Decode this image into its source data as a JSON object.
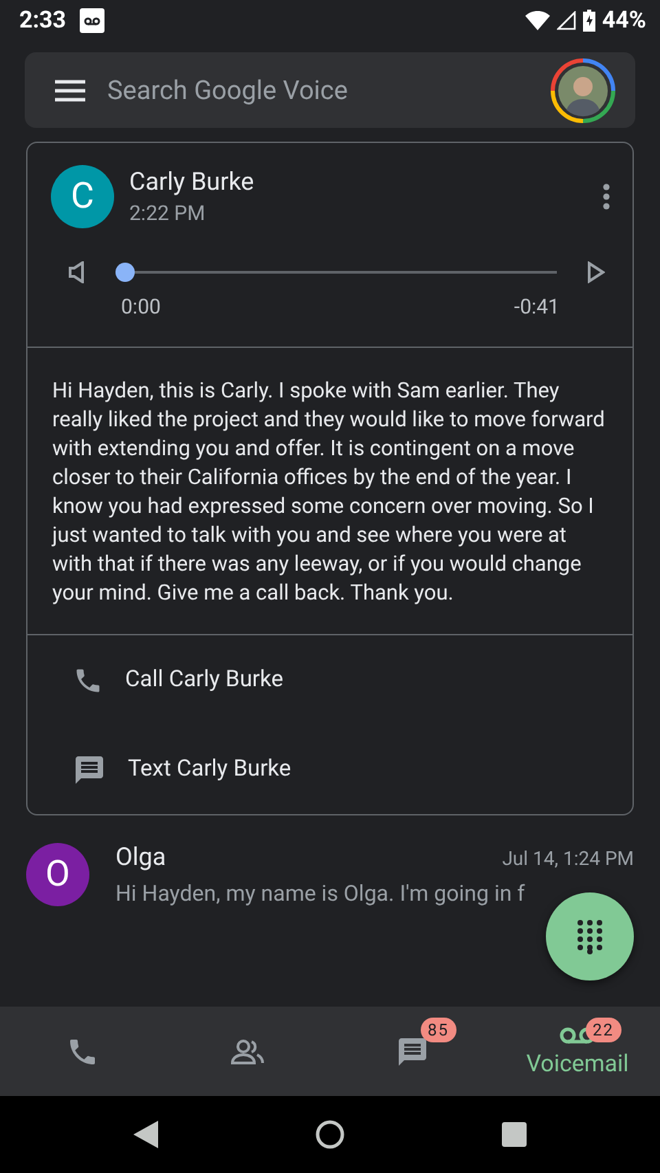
{
  "status_bar": {
    "time": "2:33",
    "battery": "44%"
  },
  "search": {
    "placeholder": "Search Google Voice"
  },
  "voicemail_card": {
    "avatar_letter": "C",
    "color": "#0097a7",
    "name": "Carly Burke",
    "time": "2:22 PM",
    "player": {
      "level": 0,
      "elapsed": "0:00",
      "remaining": "-0:41"
    },
    "transcript": "Hi Hayden, this is Carly. I spoke with Sam earlier. They really liked the project and they would like to move forward with extending you and offer. It is contingent on a move closer to their California offices by the end of the year. I know you had expressed some concern over moving. So I just wanted to talk with you and see where you were at with that if there was any leeway, or if you would change your mind. Give me a call back. Thank you.",
    "actions": [
      {
        "kind": "call",
        "label": "Call Carly Burke"
      },
      {
        "kind": "text",
        "label": "Text Carly Burke"
      }
    ]
  },
  "messages": [
    {
      "avatar_letter": "O",
      "color": "#7b1fa2",
      "name": "Olga",
      "time": "Jul 14, 1:24 PM",
      "snippet": "Hi Hayden, my name is Olga. I'm going in f"
    }
  ],
  "bottom_nav": [
    {
      "kind": "calls",
      "selected": false
    },
    {
      "kind": "contacts",
      "selected": false
    },
    {
      "kind": "messages",
      "selected": false,
      "badge": "85"
    },
    {
      "kind": "voicemail",
      "selected": true,
      "label": "Voicemail",
      "badge": "22"
    }
  ]
}
